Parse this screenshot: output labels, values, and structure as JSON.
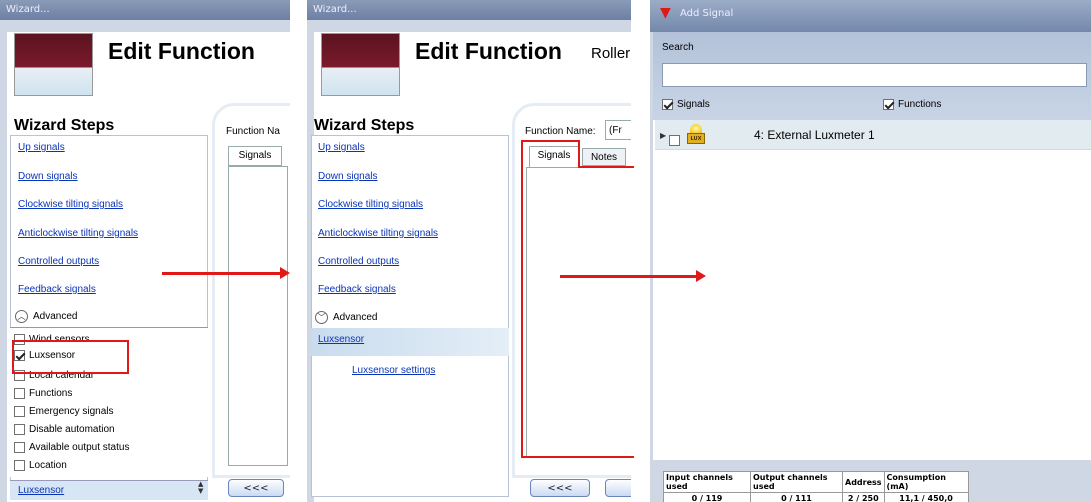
{
  "panel1": {
    "title": "Wizard...",
    "heading": "Edit Function",
    "wizard_steps": "Wizard Steps",
    "links": [
      "Up signals",
      "Down signals",
      "Clockwise tilting signals",
      "Anticlockwise tilting signals",
      "Controlled outputs",
      "Feedback signals"
    ],
    "advanced": "Advanced",
    "checkboxes": [
      {
        "label": "Wind sensors",
        "checked": false
      },
      {
        "label": "Luxsensor",
        "checked": true
      },
      {
        "label": "Local calendar",
        "checked": false
      },
      {
        "label": "Functions",
        "checked": false
      },
      {
        "label": "Emergency signals",
        "checked": false
      },
      {
        "label": "Disable automation",
        "checked": false
      },
      {
        "label": "Available output status",
        "checked": false
      },
      {
        "label": "Location",
        "checked": false
      }
    ],
    "bottom_link": "Luxsensor",
    "function_name_label": "Function Na",
    "tab_signals": "Signals",
    "back_button": "<<<"
  },
  "panel2": {
    "title": "Wizard...",
    "heading": "Edit Function",
    "subtitle": "Roller",
    "wizard_steps": "Wizard Steps",
    "links": [
      "Up signals",
      "Down signals",
      "Clockwise tilting signals",
      "Anticlockwise tilting signals",
      "Controlled outputs",
      "Feedback signals"
    ],
    "advanced": "Advanced",
    "selected_step": "Luxsensor",
    "sub_link": "Luxsensor settings",
    "function_name_label": "Function Name:",
    "function_name_value": "(Fr",
    "tab_signals": "Signals",
    "tab_notes": "Notes",
    "back_button": "<<<"
  },
  "panel3": {
    "title": "Add Signal",
    "search_label": "Search",
    "search_value": "",
    "filter_signals": {
      "label": "Signals",
      "checked": true
    },
    "filter_functions": {
      "label": "Functions",
      "checked": true
    },
    "signal_item": "4: External Luxmeter 1",
    "sensor_icon_text": "LUX",
    "footer_headers": [
      "Input channels used",
      "Output channels used",
      "Address",
      "Consumption (mA)"
    ],
    "footer_values": [
      "0 / 119",
      "0 / 111",
      "2 / 250",
      "11,1 / 450,0"
    ]
  },
  "colors": {
    "link": "#0a34b8",
    "highlight": "#e01818",
    "titlebar": "#7789aa"
  }
}
